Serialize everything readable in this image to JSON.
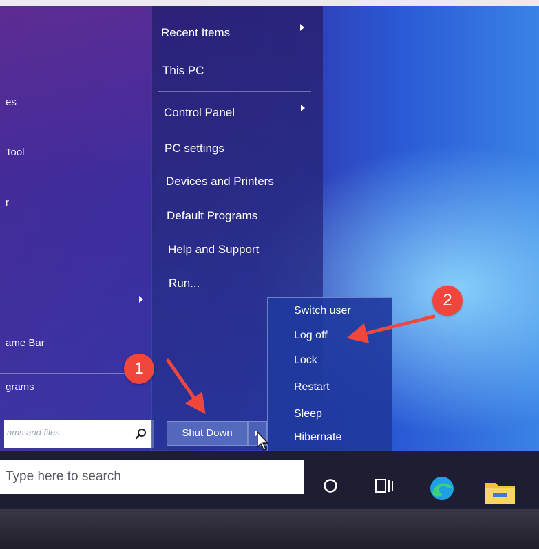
{
  "left_panel": {
    "items": [
      "es",
      "Tool",
      "r",
      "ame Bar",
      "grams"
    ],
    "search_placeholder": "ams and files"
  },
  "start_menu": {
    "items": [
      {
        "label": "Recent Items",
        "has_submenu": true
      },
      {
        "label": "This PC",
        "has_submenu": false
      },
      {
        "label": "Control Panel",
        "has_submenu": true
      },
      {
        "label": "PC settings",
        "has_submenu": false
      },
      {
        "label": "Devices and Printers",
        "has_submenu": false
      },
      {
        "label": "Default Programs",
        "has_submenu": false
      },
      {
        "label": "Help and Support",
        "has_submenu": false
      },
      {
        "label": "Run...",
        "has_submenu": false
      }
    ],
    "shutdown_label": "Shut Down"
  },
  "power_menu": {
    "items": [
      "Switch user",
      "Log off",
      "Lock",
      "Restart",
      "Sleep",
      "Hibernate"
    ]
  },
  "annotations": {
    "badge_1": "1",
    "badge_2": "2",
    "color": "#f0463c"
  },
  "taskbar": {
    "search_placeholder": "Type here to search",
    "icons": [
      "cortana-icon",
      "task-view-icon",
      "edge-icon",
      "file-explorer-icon"
    ]
  }
}
